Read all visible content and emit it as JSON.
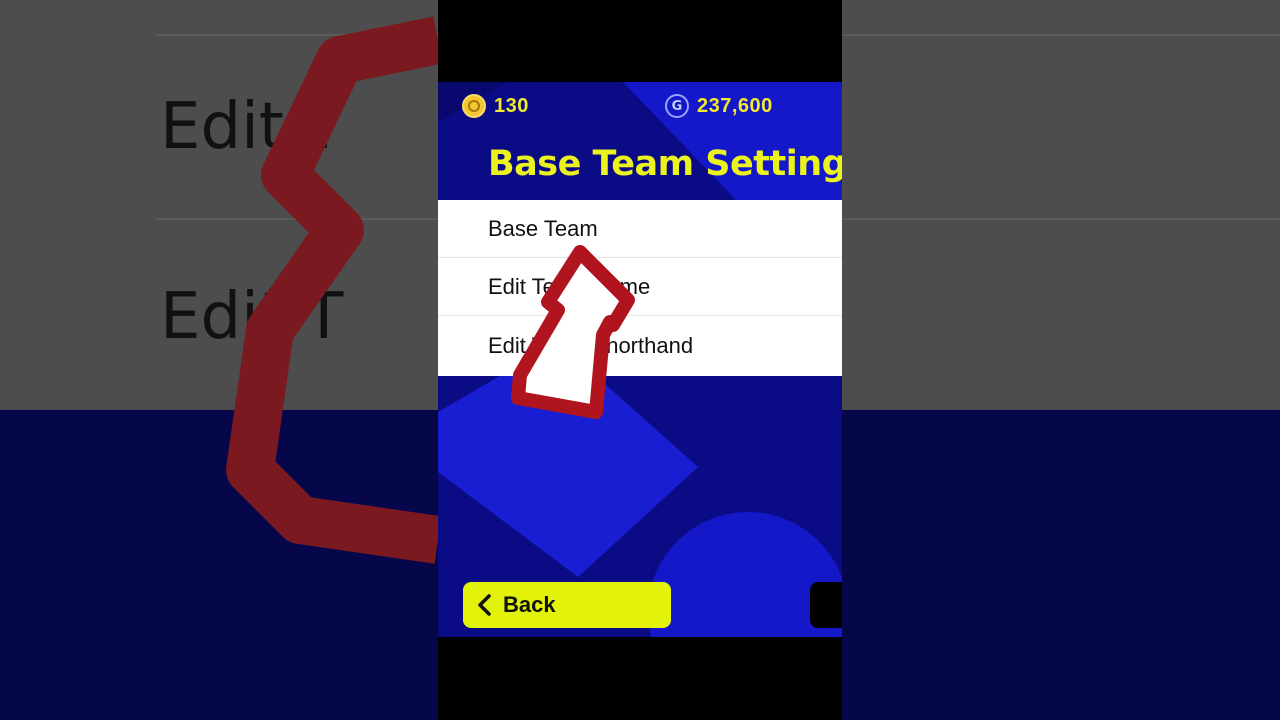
{
  "header": {
    "coins": {
      "icon": "coin-icon",
      "value": "130"
    },
    "gp": {
      "icon": "gp-icon",
      "symbol": "G",
      "value": "237,600"
    }
  },
  "title": "Base Team Settings",
  "menu": {
    "items": [
      {
        "label": "Base Team"
      },
      {
        "label": "Edit Team Name"
      },
      {
        "label": "Edit Team Shorthand"
      }
    ]
  },
  "footer": {
    "back_label": "Back"
  },
  "background": {
    "left_text_1": "Edit T",
    "left_text_2": "Edit T"
  },
  "colors": {
    "accent_yellow": "#e2f20a",
    "title_yellow": "#ecf21c",
    "screen_blue": "#0a0a7a",
    "arrow_red": "#b0151f"
  }
}
